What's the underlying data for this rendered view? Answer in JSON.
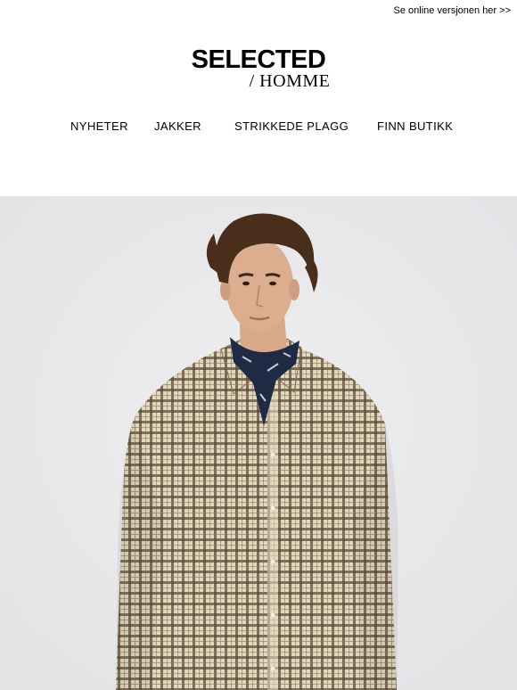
{
  "header": {
    "online_link": "Se online versjonen her >>"
  },
  "logo": {
    "main": "SELECTED",
    "sub": "/ HOMME"
  },
  "nav": {
    "items": [
      {
        "label": "NYHETER"
      },
      {
        "label": "JAKKER"
      },
      {
        "label": "STRIKKEDE PLAGG"
      },
      {
        "label": "FINN BUTIKK"
      }
    ]
  },
  "hero": {
    "image": "model-in-checkered-shirt-and-navy-neckerchief",
    "background_color": "#e9e9eb",
    "shirt_color": "#e2d6bd",
    "check_color": "#5b4a36",
    "scarf_color": "#1f2a44",
    "hair_color": "#4a2e1c"
  }
}
